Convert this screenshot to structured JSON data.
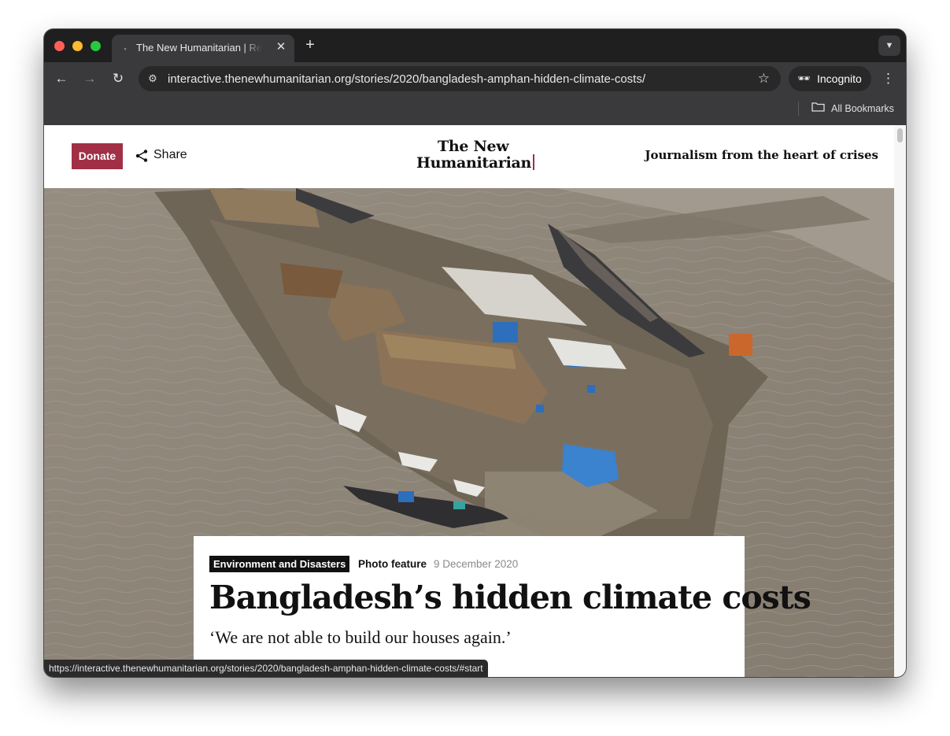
{
  "browser": {
    "tab": {
      "title": "The New Humanitarian | Reporting from the heart of crises",
      "favicon": "tnh-favicon",
      "close_icon": "close-icon"
    },
    "new_tab_icon": "plus-icon",
    "tab_menu_icon": "chevron-down-icon",
    "toolbar": {
      "back_icon": "arrow-left-icon",
      "forward_icon": "arrow-right-icon",
      "reload_icon": "reload-icon",
      "site_settings_icon": "tune-icon",
      "url": "interactive.thenewhumanitarian.org/stories/2020/bangladesh-amphan-hidden-climate-costs/",
      "bookmark_icon": "star-icon",
      "incognito_label": "Incognito",
      "menu_icon": "kebab-icon"
    },
    "bookmarks_bar": {
      "folder_label": "All Bookmarks"
    },
    "status_url": "https://interactive.thenewhumanitarian.org/stories/2020/bangladesh-amphan-hidden-climate-costs/#start"
  },
  "site": {
    "donate_label": "Donate",
    "share_label": "Share",
    "logo_line1": "The New",
    "logo_line2": "Humanitarian",
    "tagline": "Journalism from the heart of crises"
  },
  "article": {
    "category": "Environment and Disasters",
    "type": "Photo feature",
    "date": "9 December 2020",
    "headline": "Bangladesh’s hidden climate costs",
    "subtitle": "‘We are not able to build our houses again.’"
  },
  "colors": {
    "brand_accent": "#a12f46",
    "water": "#8e8579",
    "mud": "#6e6557"
  }
}
